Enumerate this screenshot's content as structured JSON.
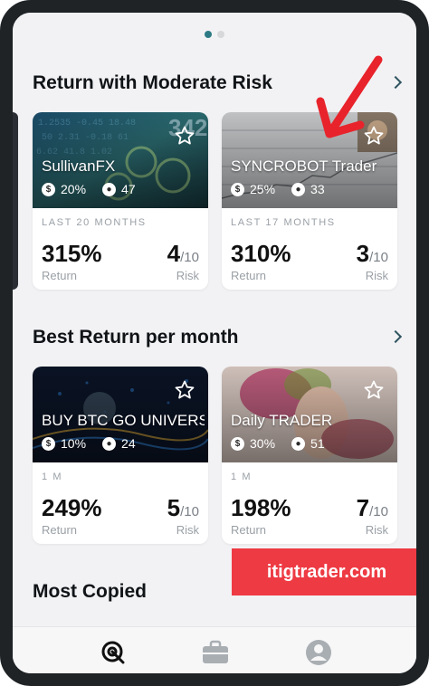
{
  "pager": {
    "count": 2,
    "active": 0
  },
  "sections": [
    {
      "title": "Return with Moderate Risk",
      "cards": [
        {
          "name": "SullivanFX",
          "return_rate": "20%",
          "copiers": "47",
          "period": "LAST 20 MONTHS",
          "return": "315%",
          "return_label": "Return",
          "risk": "4",
          "risk_den": "/10",
          "risk_label": "Risk"
        },
        {
          "name": "SYNCROBOT Trader",
          "return_rate": "25%",
          "copiers": "33",
          "period": "LAST 17 MONTHS",
          "return": "310%",
          "return_label": "Return",
          "risk": "3",
          "risk_den": "/10",
          "risk_label": "Risk"
        }
      ]
    },
    {
      "title": "Best Return per month",
      "cards": [
        {
          "name": "BUY BTC GO UNIVERSE",
          "return_rate": "10%",
          "copiers": "24",
          "period": "1 M",
          "return": "249%",
          "return_label": "Return",
          "risk": "5",
          "risk_den": "/10",
          "risk_label": "Risk"
        },
        {
          "name": "Daily TRADER",
          "return_rate": "30%",
          "copiers": "51",
          "period": "1 M",
          "return": "198%",
          "return_label": "Return",
          "risk": "7",
          "risk_den": "/10",
          "risk_label": "Risk"
        }
      ]
    },
    {
      "title": "Most Copied"
    }
  ],
  "watermark": "itigtrader.com",
  "icons": {
    "star": "star-outline-icon",
    "return_rate": "dollar-circle-icon",
    "copiers": "person-circle-icon",
    "nav": [
      "discover-icon",
      "briefcase-icon",
      "profile-icon"
    ]
  },
  "colors": {
    "accent": "#2d7a85",
    "watermark_bg": "#ee3a43",
    "arrow": "#e8232b"
  }
}
